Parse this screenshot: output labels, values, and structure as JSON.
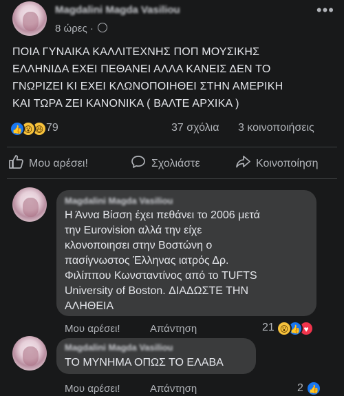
{
  "post": {
    "author": "Magdalini Magda Vasiliou",
    "time": "8 ώρες ·",
    "more": "•••",
    "text_lines": [
      "ΠΟΙΑ ΓΥΝΑΙΚΑ ΚΑΛΛΙΤΕΧΝΗΣ ΠΟΠ  ΜΟΥΣΙΚΗΣ",
      "ΕΛΛΗΝΙΔΑ  ΕΧΕΙ ΠΕΘΑΝΕΙ  ΑΛΛΑ ΚΑΝΕΙΣ ΔΕΝ ΤΟ",
      "ΓΝΩΡΙΖΕΙ  ΚΙ  ΕΧΕΙ ΚΛΩΝΟΠΟΙΗΘΕΙ ΣΤΗΝ ΑΜΕΡΙΚΗ",
      "ΚΑΙ ΤΩΡΑ ΖΕΙ ΚΑΝΟΝΙΚΑ ( ΒΑΛΤΕ ΑΡΧΙΚΑ )"
    ],
    "reaction_count": "79",
    "comments_count": "37 σχόλια",
    "shares_count": "3 κοινοποιήσεις",
    "actions": {
      "like": "Μου αρέσει!",
      "comment": "Σχολιάστε",
      "share": "Κοινοποίηση"
    }
  },
  "comments": [
    {
      "author": "Magdalini Magda Vasiliou",
      "text_lines": [
        "Η Άννα Βίσση έχει πεθάνει το 2006 μετά",
        "την Eurovision αλλά την είχε",
        "κλονοποιησει στην Βοστώνη ο",
        "πασίγνωστος Έλληνας ιατρός Δρ.",
        "Φιλίππου Κωνσταντίνος από το TUFTS",
        "University of Boston. ΔΙΑΔΩΣΤΕ ΤΗΝ",
        "ΑΛΗΘΕΙΑ"
      ],
      "like_label": "Μου αρέσει!",
      "reply_label": "Απάντηση",
      "reaction_count": "21"
    },
    {
      "author": "Magdalini Magda Vasiliou",
      "text_lines": [
        "ΤΟ ΜΥΝΗΜΑ ΟΠΩΣ ΤΟ ΕΛΑΒΑ"
      ],
      "like_label": "Μου αρέσει!",
      "reply_label": "Απάντηση",
      "reaction_count": "2"
    }
  ],
  "icons": {
    "like": "like-icon",
    "wow": "wow-icon",
    "haha": "haha-icon",
    "love": "love-icon",
    "comment": "comment-icon",
    "share": "share-icon",
    "globe": "globe-icon"
  },
  "colors": {
    "background": "#18191a",
    "bubble": "#3a3b3c",
    "text": "#e4e6eb",
    "secondary": "#b0b3b8",
    "like_blue": "#1877f2",
    "love_red": "#f0344c",
    "wow_yellow": "#f7c23c"
  }
}
